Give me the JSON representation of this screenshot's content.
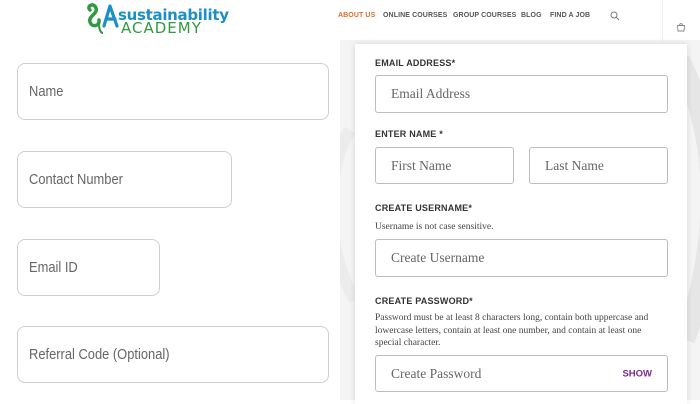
{
  "brand": {
    "logo_mark": "SA",
    "name_line1": "sustainability",
    "name_line2": "ACADEMY"
  },
  "nav": {
    "items": [
      {
        "label": "ABOUT US",
        "active": true
      },
      {
        "label": "ONLINE COURSES",
        "active": false
      },
      {
        "label": "GROUP COURSES",
        "active": false
      },
      {
        "label": "BLOG",
        "active": false
      },
      {
        "label": "FIND A JOB",
        "active": false
      }
    ],
    "icons": [
      "search-icon",
      "cart-icon"
    ],
    "accent_color": "#e26a2c"
  },
  "left_form": {
    "name_placeholder": "Name",
    "contact_placeholder": "Contact Number",
    "email_placeholder": "Email ID",
    "referral_placeholder": "Referral Code (Optional)"
  },
  "registration": {
    "email_label": "EMAIL ADDRESS*",
    "email_placeholder": "Email Address",
    "name_label": "ENTER NAME *",
    "first_name_placeholder": "First Name",
    "last_name_placeholder": "Last Name",
    "username_label": "CREATE USERNAME*",
    "username_hint": "Username is not case sensitive.",
    "username_placeholder": "Create Username",
    "password_label": "CREATE PASSWORD*",
    "password_hint": "Password must be at least 8 characters long, contain both uppercase and lowercase letters, contain at least one number, and contain at least one special character.",
    "password_placeholder": "Create Password",
    "show_label": "SHOW",
    "show_color": "#7b2a8d"
  }
}
